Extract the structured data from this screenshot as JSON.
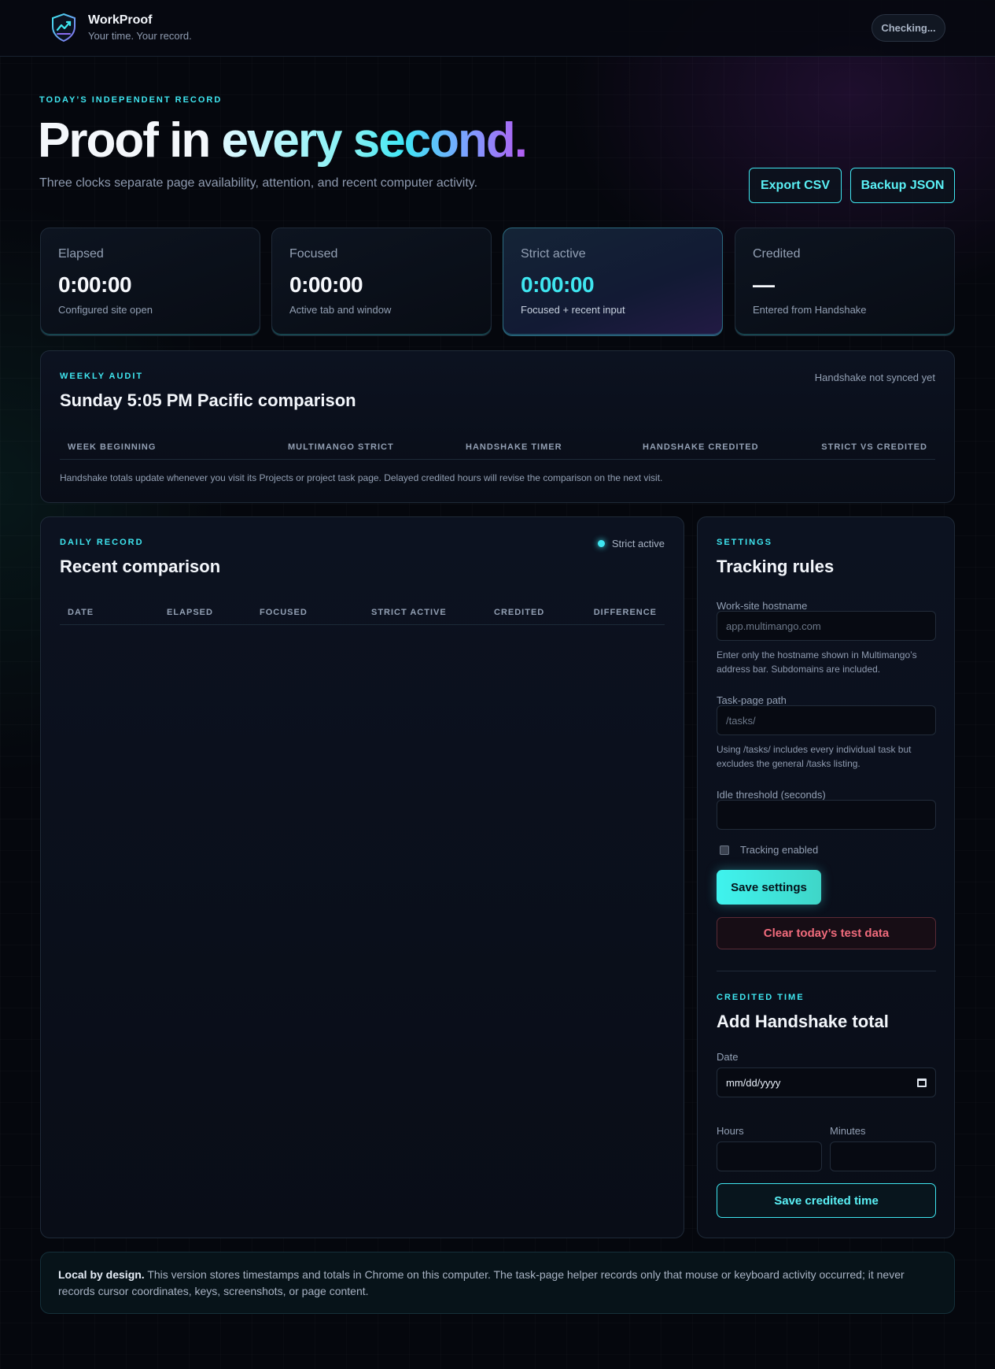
{
  "app": {
    "name": "WorkProof",
    "tagline": "Your time. Your record.",
    "status": "Checking..."
  },
  "hero": {
    "eyebrow": "TODAY’S INDEPENDENT RECORD",
    "title_part1": "Proof in",
    "title_part2": "every second.",
    "subtitle": "Three clocks separate page availability, attention, and recent computer activity.",
    "export_label": "Export CSV",
    "backup_label": "Backup JSON"
  },
  "stats": [
    {
      "label": "Elapsed",
      "value": "0:00:00",
      "note": "Configured site open"
    },
    {
      "label": "Focused",
      "value": "0:00:00",
      "note": "Active tab and window"
    },
    {
      "label": "Strict active",
      "value": "0:00:00",
      "note": "Focused + recent input"
    },
    {
      "label": "Credited",
      "value": "—",
      "note": "Entered from Handshake"
    }
  ],
  "weekly": {
    "eyebrow": "WEEKLY AUDIT",
    "title": "Sunday 5:05 PM Pacific comparison",
    "sync_status": "Handshake not synced yet",
    "columns": [
      "WEEK BEGINNING",
      "MULTIMANGO STRICT",
      "HANDSHAKE TIMER",
      "HANDSHAKE CREDITED",
      "STRICT VS CREDITED"
    ],
    "note": "Handshake totals update whenever you visit its Projects or project task page. Delayed credited hours will revise the comparison on the next visit."
  },
  "daily": {
    "eyebrow": "DAILY RECORD",
    "title": "Recent comparison",
    "indicator": "Strict active",
    "columns": [
      "DATE",
      "ELAPSED",
      "FOCUSED",
      "STRICT ACTIVE",
      "CREDITED",
      "DIFFERENCE"
    ]
  },
  "settings": {
    "eyebrow": "SETTINGS",
    "title": "Tracking rules",
    "hostname_label": "Work-site hostname",
    "hostname_placeholder": "app.multimango.com",
    "hostname_help": "Enter only the hostname shown in Multimango’s address bar. Subdomains are included.",
    "path_label": "Task-page path",
    "path_placeholder": "/tasks/",
    "path_help": "Using /tasks/ includes every individual task but excludes the general /tasks listing.",
    "idle_label": "Idle threshold (seconds)",
    "idle_value": "",
    "tracking_label": "Tracking enabled",
    "save_label": "Save settings",
    "clear_label": "Clear today’s test data"
  },
  "credited": {
    "eyebrow": "CREDITED TIME",
    "title": "Add Handshake total",
    "date_label": "Date",
    "date_placeholder": "mm/dd/yyyy",
    "hours_label": "Hours",
    "minutes_label": "Minutes",
    "save_label": "Save credited time"
  },
  "footer": {
    "lead": "Local by design.",
    "text": "This version stores timestamps and totals in Chrome on this computer. The task-page helper records only that mouse or keyboard activity occurred; it never records cursor coordinates, keys, screenshots, or page content."
  },
  "colors": {
    "accent": "#3fe6f0",
    "accent_purple": "#b35cf2",
    "danger": "#f06b7c",
    "background": "#05070d"
  },
  "icons": {
    "logo": "shield-chart-icon",
    "calendar": "calendar-icon",
    "indicator": "status-dot-icon"
  }
}
